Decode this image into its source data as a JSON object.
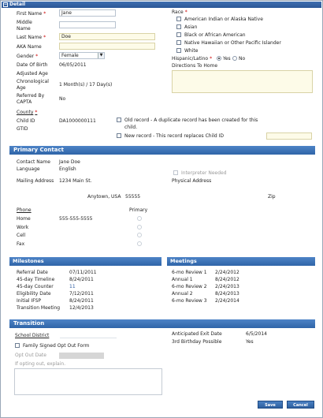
{
  "window": {
    "title": "Detail"
  },
  "detail": {
    "first_name": {
      "label": "First Name",
      "value": "Jane"
    },
    "middle_name": {
      "label_1": "Middle",
      "label_2": "Name",
      "value": ""
    },
    "last_name": {
      "label": "Last Name",
      "value": "Doe"
    },
    "aka_name": {
      "label": "AKA Name",
      "value": ""
    },
    "gender": {
      "label": "Gender",
      "value": "Female"
    },
    "dob": {
      "label": "Date Of Birth",
      "value": "06/05/2011"
    },
    "adjusted_age": {
      "label": "Adjusted Age",
      "value": ""
    },
    "chrono_age": {
      "label_1": "Chronological",
      "label_2": "Age",
      "value": "1 Month(s) / 17 Day(s)"
    },
    "referred_by": {
      "label_1": "Referred By",
      "label_2": "CAPTA",
      "value": "No"
    },
    "county": {
      "label": "County"
    },
    "child_id": {
      "label": "Child ID",
      "value": "DA1000000111"
    },
    "gtid": {
      "label": "GTID"
    },
    "old_record": {
      "label_1": "Old record - A duplicate record has been created for this",
      "label_2": "child."
    },
    "new_record": {
      "label": "New record - This record replaces Child ID"
    },
    "race": {
      "label": "Race",
      "options": [
        "American Indian or Alaska Native",
        "Asian",
        "Black or African American",
        "Native Hawaiian or Other Pacific Islander",
        "White"
      ]
    },
    "hispanic": {
      "label": "Hispanic/Latino",
      "yes": "Yes",
      "no": "No",
      "selected": "Yes"
    },
    "directions": {
      "label": "Directions To Home"
    }
  },
  "primary_contact": {
    "title": "Primary Contact",
    "contact_name": {
      "label": "Contact Name",
      "value": "Jane Doe"
    },
    "language": {
      "label": "Language",
      "value": "English"
    },
    "interpreter": {
      "label": "Interpreter Needed"
    },
    "mailing": {
      "label": "Mailing Address",
      "value": "1234 Main St."
    },
    "physical": {
      "label": "Physical Address"
    },
    "city_state": "Anytown, USA",
    "zip": "55555",
    "physical_zip_label": "Zip",
    "phone_header": "Phone",
    "primary_header": "Primary",
    "phones": [
      {
        "label": "Home",
        "value": "555-555-5555"
      },
      {
        "label": "Work",
        "value": ""
      },
      {
        "label": "Cell",
        "value": ""
      },
      {
        "label": "Fax",
        "value": ""
      }
    ]
  },
  "milestones": {
    "title": "Milestones",
    "rows": [
      {
        "label": "Referral Date",
        "value": "07/11/2011"
      },
      {
        "label": "45-day Timeline",
        "value": "8/24/2011"
      },
      {
        "label": "45-day Counter",
        "value": "11"
      },
      {
        "label": "Eligibility Date",
        "value": "7/12/2011"
      },
      {
        "label": "Initial IFSP",
        "value": "8/24/2011"
      },
      {
        "label": "Transition Meeting",
        "value": "12/4/2013"
      }
    ]
  },
  "meetings": {
    "title": "Meetings",
    "rows": [
      {
        "label": "6-mo Review 1",
        "value": "2/24/2012"
      },
      {
        "label": "Annual 1",
        "value": "8/24/2012"
      },
      {
        "label": "6-mo Review 2",
        "value": "2/24/2013"
      },
      {
        "label": "Annual 2",
        "value": "8/24/2013"
      },
      {
        "label": "6-mo Review 3",
        "value": "2/24/2014"
      }
    ]
  },
  "transition": {
    "title": "Transition",
    "school_district": {
      "label": "School District"
    },
    "opt_out_form": {
      "label": "Family Signed Opt Out Form"
    },
    "opt_out_date": {
      "label": "Opt Out Date"
    },
    "explain": {
      "label": "If opting out, explain."
    },
    "anticipated_exit": {
      "label": "Anticipated Exit Date",
      "value": "6/5/2014"
    },
    "third_birthday": {
      "label": "3rd Birthday Possible",
      "value": "Yes"
    }
  },
  "buttons": {
    "save": "Save",
    "cancel": "Cancel"
  },
  "colors": {
    "header_blue": "#2f65a8",
    "required_red": "#cc0000"
  }
}
